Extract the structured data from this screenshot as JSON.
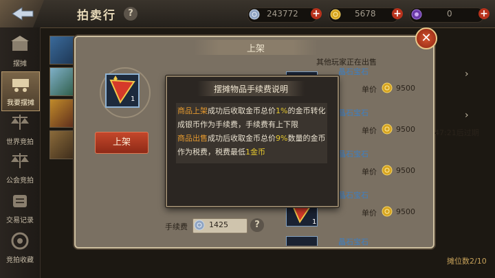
{
  "topbar": {
    "title": "拍卖行",
    "help": "?",
    "silver": "243772",
    "gold": "5678",
    "gem": "0",
    "plus": "+"
  },
  "sidebar": {
    "items": [
      {
        "label": "摆摊"
      },
      {
        "label": "我要摆摊"
      },
      {
        "label": "世界竞拍"
      },
      {
        "label": "公会竞拍"
      },
      {
        "label": "交易记录"
      },
      {
        "label": "竞拍收藏"
      }
    ]
  },
  "panel": {
    "title": "上架",
    "item_count": "1",
    "list_button": "上架",
    "fee_label": "手续费",
    "fee_value": "1425",
    "fee_help": "?"
  },
  "listings": {
    "header": "其他玩家正在出售",
    "price_label": "单价",
    "rows": [
      {
        "name": "晶石宝石",
        "price": "9500"
      },
      {
        "name": "晶石宝石",
        "price": "9500"
      },
      {
        "name": "晶石宝石",
        "price": "9500"
      },
      {
        "name": "晶石宝石",
        "price": "9500",
        "qty": "1"
      },
      {
        "name": "晶石宝石",
        "price": ""
      }
    ]
  },
  "right": {
    "time_text": "47:21后过期",
    "slots": "摊位数2/10"
  },
  "modal": {
    "title": "摆摊物品手续费说明",
    "p1_a": "商品上架",
    "p1_b": "成功后收取金币总价",
    "p1_c": "1%",
    "p1_d": "的金币转化成银币作为手续费，手续费有上下限",
    "p2_a": "商品出售",
    "p2_b": "成功后收取金币总价",
    "p2_c": "9%",
    "p2_d": "数量的金币作为税费，税费最低",
    "p2_e": "1金币"
  },
  "colors": {
    "accent_red": "#b8321c",
    "highlight_orange": "#e69a2e",
    "highlight_yellow": "#e6c82e",
    "link_blue": "#3c7fc4"
  }
}
